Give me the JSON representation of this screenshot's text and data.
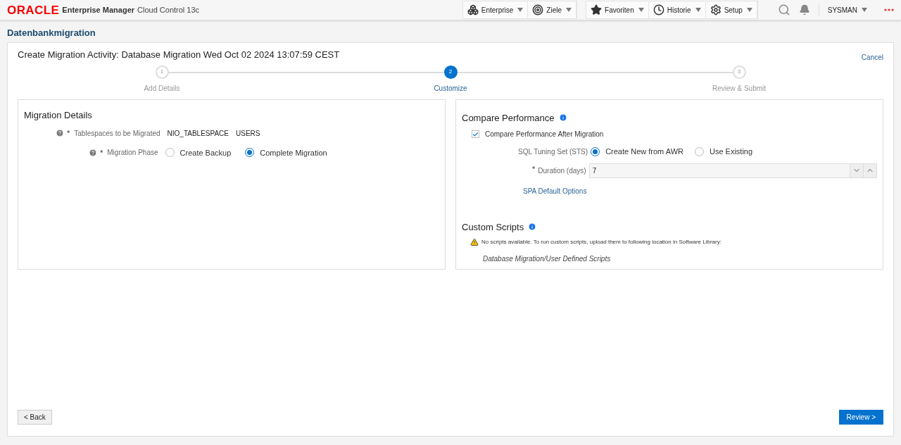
{
  "header": {
    "logo": "ORACLE",
    "product": "Enterprise Manager",
    "edition": "Cloud Control 13c",
    "menu_groups": [
      [
        {
          "label": "Enterprise",
          "kind": "enterprise"
        },
        {
          "label": "Ziele",
          "kind": "targets"
        }
      ],
      [
        {
          "label": "Favoriten",
          "kind": "favorites"
        },
        {
          "label": "Historie",
          "kind": "history"
        },
        {
          "label": "Setup",
          "kind": "setup"
        }
      ]
    ],
    "user": "SYSMAN"
  },
  "page_title": "Datenbankmigration",
  "activity_title": "Create Migration Activity: Database Migration Wed Oct 02 2024 13:07:59 CEST",
  "cancel": "Cancel",
  "steps": [
    {
      "number": "1",
      "label": "Add Details",
      "selected": false
    },
    {
      "number": "2",
      "label": "Customize",
      "selected": true
    },
    {
      "number": "3",
      "label": "Review & Submit",
      "selected": false
    }
  ],
  "migration_details": {
    "title": "Migration Details",
    "tablespaces": {
      "required_mark": "*",
      "label": "Tablespaces to be Migrated",
      "values": [
        "NIO_TABLESPACE",
        "USERS"
      ]
    },
    "phase": {
      "required_mark": "*",
      "label": "Migration Phase",
      "options": [
        {
          "label": "Create Backup",
          "selected": false
        },
        {
          "label": "Complete Migration",
          "selected": true
        }
      ]
    }
  },
  "compare_performance": {
    "title": "Compare Performance",
    "checkbox": {
      "label": "Compare Performance After Migration",
      "checked": true
    },
    "sts": {
      "label": "SQL Tuning Set (STS)",
      "options": [
        {
          "label": "Create New from AWR",
          "selected": true
        },
        {
          "label": "Use Existing",
          "selected": false
        }
      ]
    },
    "duration": {
      "required_mark": "*",
      "label": "Duration (days)",
      "value": "7"
    },
    "link": "SPA Default Options"
  },
  "custom_scripts": {
    "title": "Custom Scripts",
    "warning": "No scripts available. To run custom scripts, upload them to following location in Software Library:",
    "path": "Database Migration/User Defined Scripts"
  },
  "buttons": {
    "back": "< Back",
    "review": "Review >"
  }
}
